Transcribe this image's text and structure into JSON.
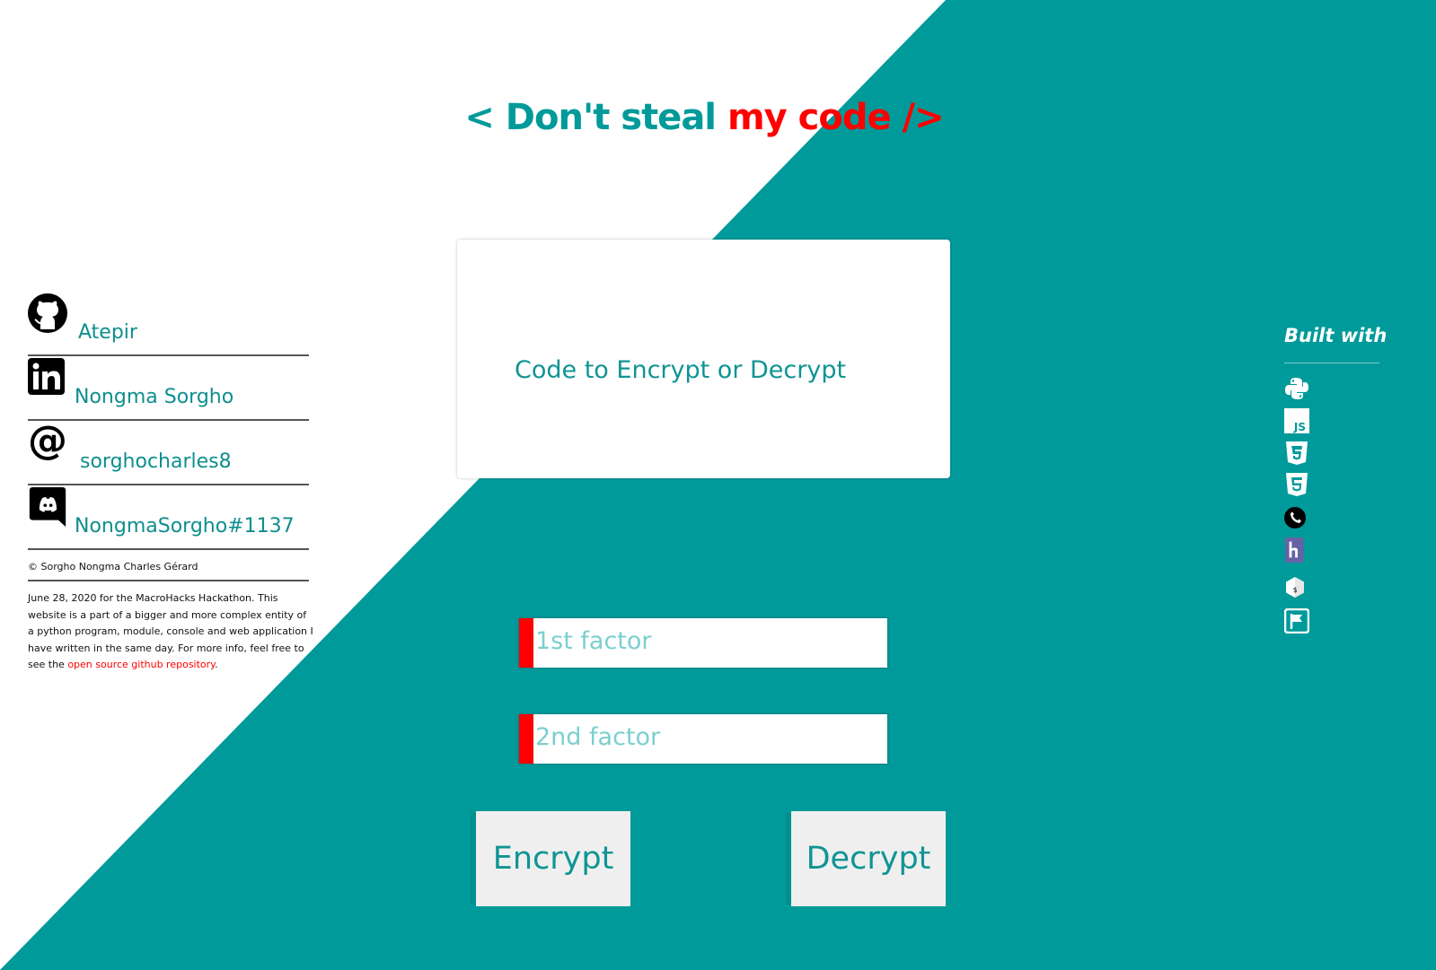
{
  "colors": {
    "teal": "#009a9a",
    "red": "#ff0000",
    "white": "#ffffff",
    "button_bg": "#efefef"
  },
  "header": {
    "title_part1": "< Don't steal ",
    "title_part2": "my code />"
  },
  "editor": {
    "placeholder": "Code to Encrypt or Decrypt"
  },
  "factors": {
    "first_placeholder": "1st factor",
    "second_placeholder": "2nd factor"
  },
  "actions": {
    "encrypt_label": "Encrypt",
    "decrypt_label": "Decrypt"
  },
  "contacts": {
    "items": [
      {
        "icon": "github-icon",
        "label": "Atepir"
      },
      {
        "icon": "linkedin-icon",
        "label": "Nongma Sorgho"
      },
      {
        "icon": "at-icon",
        "label": "sorghocharles8"
      },
      {
        "icon": "discord-icon",
        "label": "NongmaSorgho#1137"
      }
    ],
    "copyright_symbol": "©",
    "copyright": "Sorgho Nongma Charles Gérard",
    "about_text": "June 28, 2020 for the MacroHacks Hackathon. This website is a part of a bigger and more complex entity of a python program, module, console and web application I have written in the same day. For more info, feel free to see the ",
    "about_link": "open source github repository",
    "about_end": "."
  },
  "built_with": {
    "title": "Built with",
    "icons": [
      "python-icon",
      "javascript-icon",
      "css3-icon",
      "html5-icon",
      "phone-icon",
      "heroku-icon",
      "bash-icon",
      "flask-icon"
    ]
  }
}
